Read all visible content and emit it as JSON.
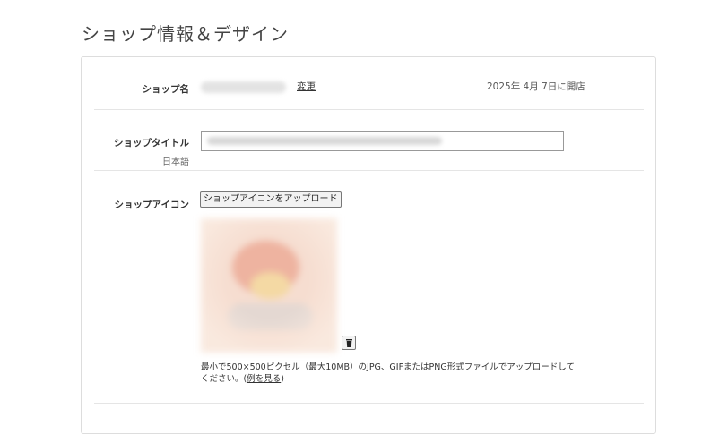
{
  "page": {
    "title": "ショップ情報＆デザイン"
  },
  "shop_name": {
    "label": "ショップ名",
    "change_link": "変更",
    "open_date": "2025年 4月 7日に開店"
  },
  "shop_title": {
    "label": "ショップタイトル",
    "sublabel": "日本語",
    "value": ""
  },
  "shop_icon": {
    "label": "ショップアイコン",
    "upload_button": "ショップアイコンをアップロード",
    "help_text_before": "最小で500×500ピクセル（最大10MB）のJPG、GIFまたはPNG形式ファイルでアップロードしてください。(",
    "help_link": "例を見る",
    "help_text_after": ")"
  },
  "colors": {
    "border": "#dddddd",
    "divider": "#e5e5e5",
    "text": "#333333"
  }
}
